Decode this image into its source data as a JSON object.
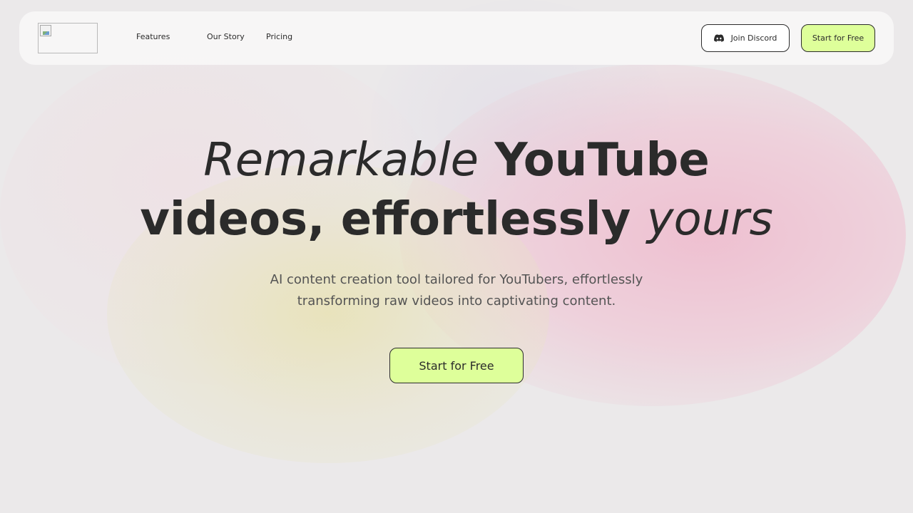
{
  "nav": {
    "logo_alt": "",
    "links": [
      "Features",
      "Our Story",
      "Pricing"
    ],
    "discord_label": "Join Discord",
    "discord_icon": "discord-icon",
    "cta_label": "Start for Free"
  },
  "hero": {
    "headline_line1_italic": "Remarkable",
    "headline_line1_bold": "YouTube",
    "headline_line2_bold": "videos, effortlessly",
    "headline_line2_italic": "yours",
    "subtitle_line1": "AI content creation tool tailored for YouTubers, effortlessly",
    "subtitle_line2": "transforming raw videos into captivating content.",
    "cta_label": "Start for Free"
  },
  "colors": {
    "accent": "#deff9a",
    "text": "#2b2b2b",
    "subtext": "#545454",
    "background": "#ebe9ea",
    "navbar": "#f8f7f7"
  }
}
